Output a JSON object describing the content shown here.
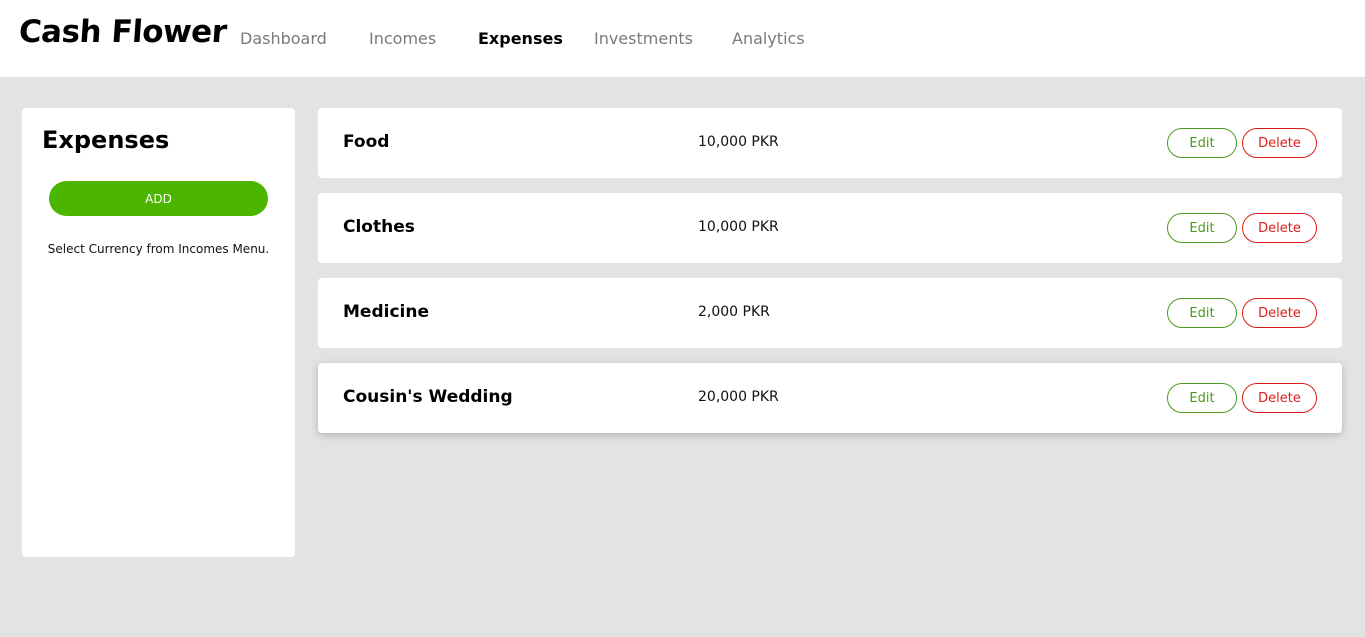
{
  "brand": "Cash Flower",
  "nav": [
    {
      "label": "Dashboard",
      "active": false
    },
    {
      "label": "Incomes",
      "active": false
    },
    {
      "label": "Expenses",
      "active": true
    },
    {
      "label": "Investments",
      "active": false
    },
    {
      "label": "Analytics",
      "active": false
    }
  ],
  "sidebar": {
    "title": "Expenses",
    "add_label": "ADD",
    "note": "Select Currency from Incomes Menu."
  },
  "expenses": [
    {
      "name": "Food",
      "amount": "10,000 PKR"
    },
    {
      "name": "Clothes",
      "amount": "10,000 PKR"
    },
    {
      "name": "Medicine",
      "amount": "2,000 PKR"
    },
    {
      "name": "Cousin's Wedding",
      "amount": "20,000 PKR"
    }
  ],
  "actions": {
    "edit_label": "Edit",
    "delete_label": "Delete"
  },
  "colors": {
    "accent_green": "#4cb500",
    "edit_green": "#4c9a1c",
    "delete_red": "#e01b1b",
    "background": "#e3e3e3"
  }
}
